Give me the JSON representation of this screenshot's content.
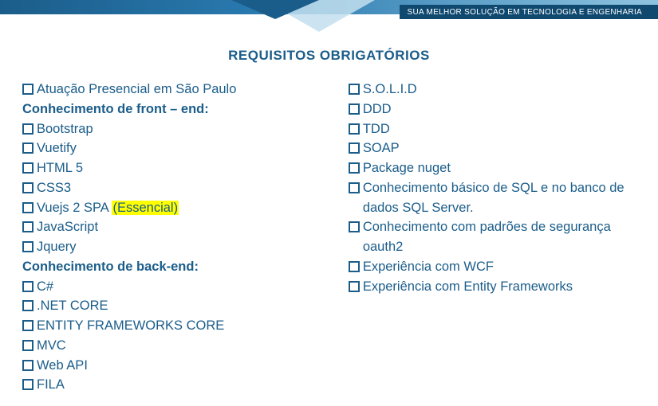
{
  "header": {
    "tagline": "SUA MELHOR SOLUÇÃO EM TECNOLOGIA E ENGENHARIA"
  },
  "title": "REQUISITOS OBRIGATÓRIOS",
  "left": {
    "intro": "Atuação Presencial em São Paulo",
    "heading_front": "Conhecimento de front – end:",
    "front": [
      "Bootstrap",
      "Vuetify",
      "HTML 5",
      "CSS3"
    ],
    "vuejs_pre": "Vuejs 2 SPA ",
    "vuejs_hl": "(Essencial)",
    "front2": [
      "JavaScript",
      "Jquery"
    ],
    "heading_back": "Conhecimento de back-end:",
    "back": [
      "C#",
      ".NET CORE",
      "ENTITY FRAMEWORKS CORE",
      "MVC",
      "Web API",
      "FILA"
    ]
  },
  "right": {
    "items": [
      "S.O.L.I.D",
      "DDD",
      "TDD",
      "SOAP",
      "Package nuget",
      "Conhecimento básico de SQL e no banco de dados SQL Server.",
      "Conhecimento com padrões de segurança oauth2",
      "Experiência com WCF",
      "Experiência com Entity Frameworks"
    ]
  }
}
